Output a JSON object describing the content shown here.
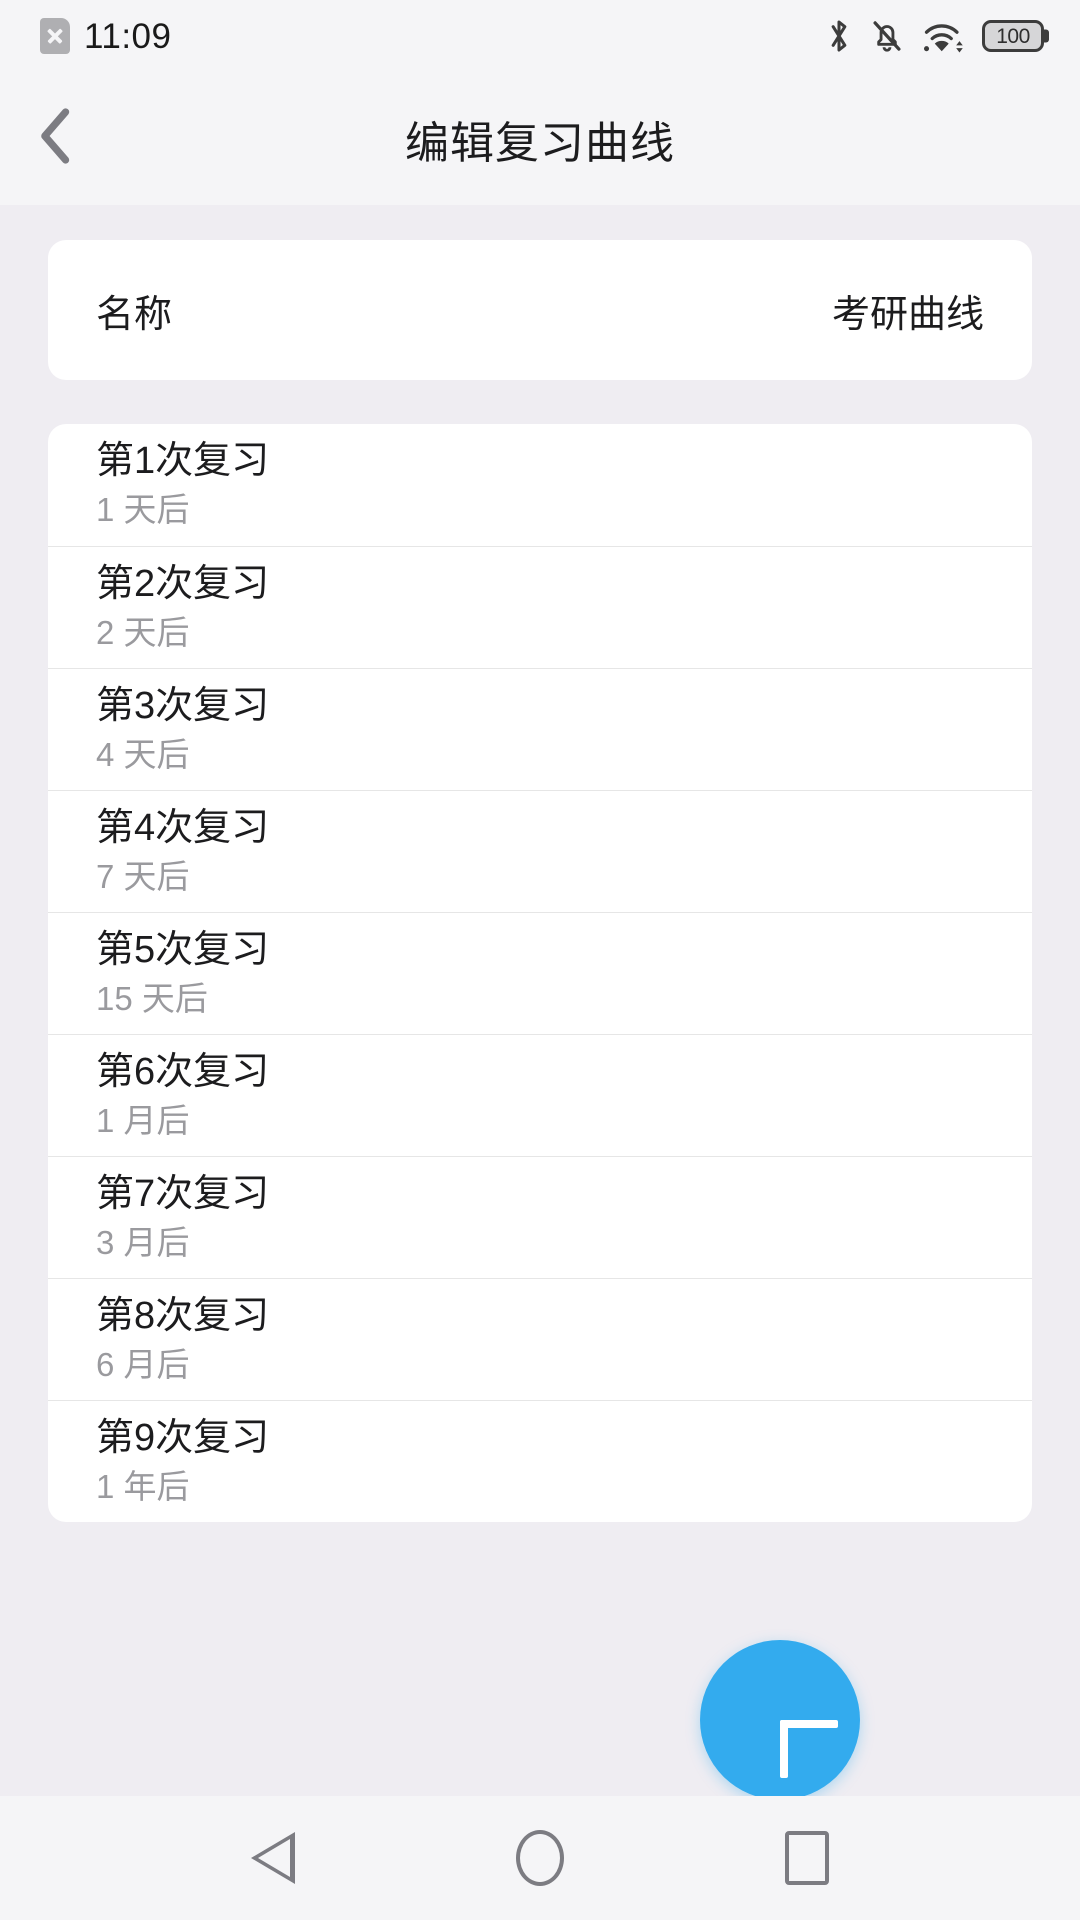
{
  "status_bar": {
    "sim_icon": "sim-card-off-icon",
    "time": "11:09",
    "bluetooth_icon": "bluetooth-icon",
    "mute_icon": "bell-muted-icon",
    "wifi_icon": "wifi-icon",
    "battery_level": "100"
  },
  "app_bar": {
    "back_icon": "chevron-left-icon",
    "title": "编辑复习曲线"
  },
  "name_card": {
    "label": "名称",
    "value": "考研曲线"
  },
  "review_list": [
    {
      "title": "第1次复习",
      "subtitle": "1 天后"
    },
    {
      "title": "第2次复习",
      "subtitle": "2 天后"
    },
    {
      "title": "第3次复习",
      "subtitle": "4 天后"
    },
    {
      "title": "第4次复习",
      "subtitle": "7 天后"
    },
    {
      "title": "第5次复习",
      "subtitle": "15 天后"
    },
    {
      "title": "第6次复习",
      "subtitle": "1 月后"
    },
    {
      "title": "第7次复习",
      "subtitle": "3 月后"
    },
    {
      "title": "第8次复习",
      "subtitle": "6 月后"
    },
    {
      "title": "第9次复习",
      "subtitle": "1 年后"
    }
  ],
  "fab": {
    "icon": "plus-icon",
    "color": "#33ABEE"
  },
  "nav_bar": {
    "back_icon": "triangle-back-icon",
    "home_icon": "circle-home-icon",
    "recents_icon": "square-recents-icon"
  },
  "colors": {
    "page_background": "#EFEDF2",
    "bar_background": "#F5F5F7",
    "card_background": "#FFFFFF",
    "primary_text": "#1C1C1E",
    "secondary_text": "#9A9A9E",
    "divider": "#E6E6E6",
    "accent": "#33ABEE"
  }
}
